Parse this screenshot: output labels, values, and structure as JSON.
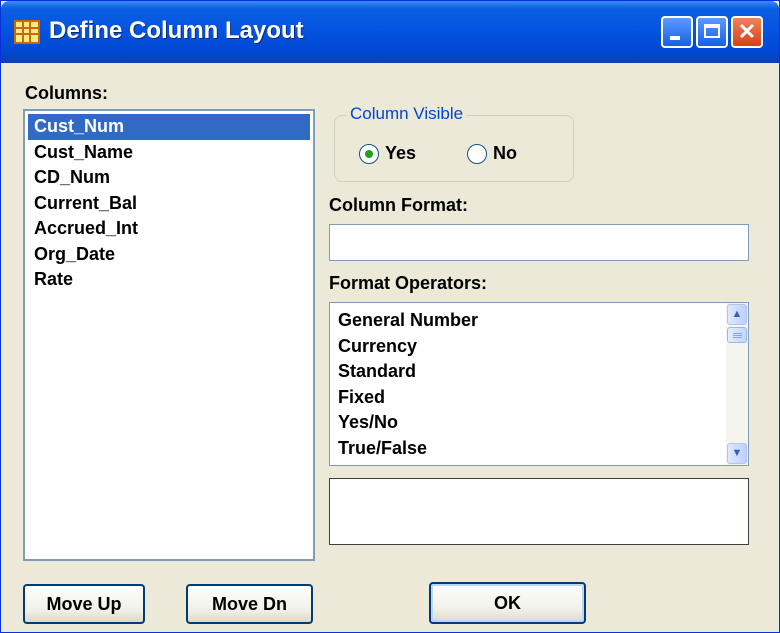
{
  "window": {
    "title": "Define Column Layout",
    "title_icon": "grid-table-icon",
    "controls": {
      "minimize": "minimize-icon",
      "maximize": "maximize-icon",
      "close": "close-icon"
    },
    "colors": {
      "titlebar": "#0554e3",
      "face": "#ece9d8",
      "selection": "#316ac5",
      "group_title": "#0046d5"
    }
  },
  "columns": {
    "label": "Columns:",
    "items": [
      "Cust_Num",
      "Cust_Name",
      "CD_Num",
      "Current_Bal",
      "Accrued_Int",
      "Org_Date",
      "Rate"
    ],
    "selected": "Cust_Num"
  },
  "visible_group": {
    "title": "Column Visible",
    "options": [
      "Yes",
      "No"
    ],
    "selected": "Yes"
  },
  "column_format": {
    "label": "Column Format:",
    "value": ""
  },
  "format_operators": {
    "label": "Format Operators:",
    "items": [
      "General Number",
      "Currency",
      "Standard",
      "Fixed",
      "Yes/No",
      "True/False"
    ],
    "scroll_up_icon": "chevron-up-icon",
    "scroll_down_icon": "chevron-down-icon"
  },
  "description": {
    "value": ""
  },
  "buttons": {
    "move_up": "Move Up",
    "move_dn": "Move Dn",
    "ok": "OK"
  }
}
